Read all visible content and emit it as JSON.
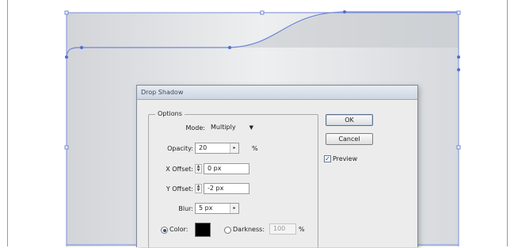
{
  "dialog": {
    "title": "Drop Shadow",
    "options_group_label": "Options",
    "mode": {
      "label": "Mode:",
      "value": "Multiply"
    },
    "opacity": {
      "label": "Opacity:",
      "value": "20",
      "unit": "%"
    },
    "x_offset": {
      "label": "X Offset:",
      "value": "0 px"
    },
    "y_offset": {
      "label": "Y Offset:",
      "value": "-2 px"
    },
    "blur": {
      "label": "Blur:",
      "value": "5 px"
    },
    "color": {
      "label": "Color:",
      "selected": true,
      "swatch": "#000000"
    },
    "darkness": {
      "label": "Darkness:",
      "value": "100",
      "unit": "%",
      "selected": false
    },
    "ok_label": "OK",
    "cancel_label": "Cancel",
    "preview": {
      "label": "Preview",
      "checked": true
    }
  },
  "colors": {
    "path_stroke": "#6f86d6",
    "dialog_bg": "#ececec",
    "title_text": "#3b4b62"
  },
  "icons": {
    "dropdown": "chevron-down-icon",
    "spin": "spinner-arrows-icon",
    "combo": "combo-arrow-icon"
  }
}
